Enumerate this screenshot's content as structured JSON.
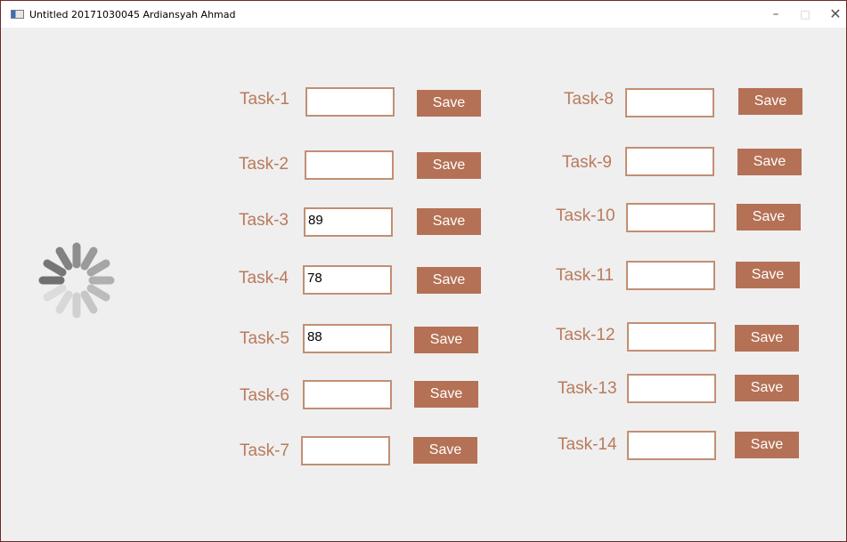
{
  "window": {
    "title": "Untitled 20171030045 Ardiansyah Ahmad",
    "controls": {
      "minimize": "–",
      "maximize": "□",
      "close": "✕"
    }
  },
  "tasks": [
    {
      "label": "Task-1",
      "value": "",
      "save_label": "Save"
    },
    {
      "label": "Task-2",
      "value": "",
      "save_label": "Save"
    },
    {
      "label": "Task-3",
      "value": "89",
      "save_label": "Save"
    },
    {
      "label": "Task-4",
      "value": "78",
      "save_label": "Save"
    },
    {
      "label": "Task-5",
      "value": "88",
      "save_label": "Save"
    },
    {
      "label": "Task-6",
      "value": "",
      "save_label": "Save"
    },
    {
      "label": "Task-7",
      "value": "",
      "save_label": "Save"
    },
    {
      "label": "Task-8",
      "value": "",
      "save_label": "Save"
    },
    {
      "label": "Task-9",
      "value": "",
      "save_label": "Save"
    },
    {
      "label": "Task-10",
      "value": "",
      "save_label": "Save"
    },
    {
      "label": "Task-11",
      "value": "",
      "save_label": "Save"
    },
    {
      "label": "Task-12",
      "value": "",
      "save_label": "Save"
    },
    {
      "label": "Task-13",
      "value": "",
      "save_label": "Save"
    },
    {
      "label": "Task-14",
      "value": "",
      "save_label": "Save"
    }
  ],
  "colors": {
    "label": "#b97a5c",
    "input_border": "#c28f73",
    "button": "#b57155",
    "window_border": "#6b2a2a"
  },
  "icons": {
    "loading": "loading-spinner-icon"
  }
}
